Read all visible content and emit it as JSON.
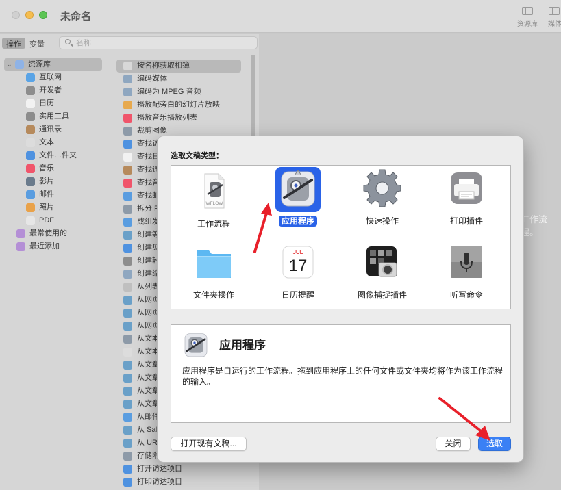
{
  "window": {
    "title": "未命名",
    "toolbar": [
      {
        "label": "资源库",
        "icon": "library-sidebar-icon"
      },
      {
        "label": "媒体",
        "icon": "media-icon"
      }
    ]
  },
  "library": {
    "segments": [
      "操作",
      "变量"
    ],
    "search_placeholder": "名称",
    "tree": [
      {
        "label": "资源库",
        "icon": "library-icon",
        "root": true
      },
      {
        "label": "互联网",
        "icon": "globe-icon"
      },
      {
        "label": "开发者",
        "icon": "tools-icon"
      },
      {
        "label": "日历",
        "icon": "calendar-icon"
      },
      {
        "label": "实用工具",
        "icon": "tools-icon"
      },
      {
        "label": "通讯录",
        "icon": "contacts-icon"
      },
      {
        "label": "文本",
        "icon": "text-icon"
      },
      {
        "label": "文件…件夹",
        "icon": "finder-icon"
      },
      {
        "label": "音乐",
        "icon": "music-icon"
      },
      {
        "label": "影片",
        "icon": "movie-icon"
      },
      {
        "label": "邮件",
        "icon": "mail-icon"
      },
      {
        "label": "照片",
        "icon": "photos-icon"
      },
      {
        "label": "PDF",
        "icon": "pdf-icon"
      },
      {
        "label": "最常使用的",
        "icon": "smart-folder-icon",
        "top": true
      },
      {
        "label": "最近添加",
        "icon": "smart-folder-icon",
        "top": true
      }
    ],
    "actions": [
      "按名称获取相簿",
      "编码媒体",
      "编码为 MPEG 音频",
      "播放配旁白的幻灯片放映",
      "播放音乐播放列表",
      "裁剪图像",
      "查找访",
      "查找日",
      "查找通",
      "查找音",
      "查找邮",
      "拆分 P",
      "成组发",
      "创建等",
      "创建见",
      "创建轻",
      "创建缩",
      "从列表",
      "从网页",
      "从网页",
      "从网页",
      "从文本",
      "从文本",
      "从文章",
      "从文章",
      "从文章",
      "从文章",
      "从邮件",
      "从 Saf",
      "从 URL",
      "存储附",
      "打开访达项目",
      "打印访达项目"
    ],
    "workflow_hint": "工作流程。"
  },
  "dialog": {
    "title": "选取文稿类型：",
    "types": [
      {
        "label": "工作流程",
        "icon": "workflow-document-icon"
      },
      {
        "label": "应用程序",
        "icon": "automator-robot-icon",
        "selected": true
      },
      {
        "label": "快速操作",
        "icon": "gear-icon"
      },
      {
        "label": "打印插件",
        "icon": "printer-icon"
      },
      {
        "label": "文件夹操作",
        "icon": "folder-icon"
      },
      {
        "label": "日历提醒",
        "icon": "calendar-icon"
      },
      {
        "label": "图像捕捉插件",
        "icon": "image-capture-icon"
      },
      {
        "label": "听写命令",
        "icon": "microphone-icon"
      }
    ],
    "calendar_icon": {
      "month": "JUL",
      "day": "17"
    },
    "workflow_icon_text": "WFLOW",
    "description": {
      "title": "应用程序",
      "text": "应用程序是自运行的工作流程。拖到应用程序上的任何文件或文件夹均将作为该工作流程的输入。"
    },
    "buttons": {
      "open": "打开现有文稿...",
      "close": "关闭",
      "choose": "选取"
    }
  },
  "colors": {
    "accent": "#3a80f5",
    "selection": "#2a63e8",
    "annotation_arrow": "#e8202a"
  }
}
